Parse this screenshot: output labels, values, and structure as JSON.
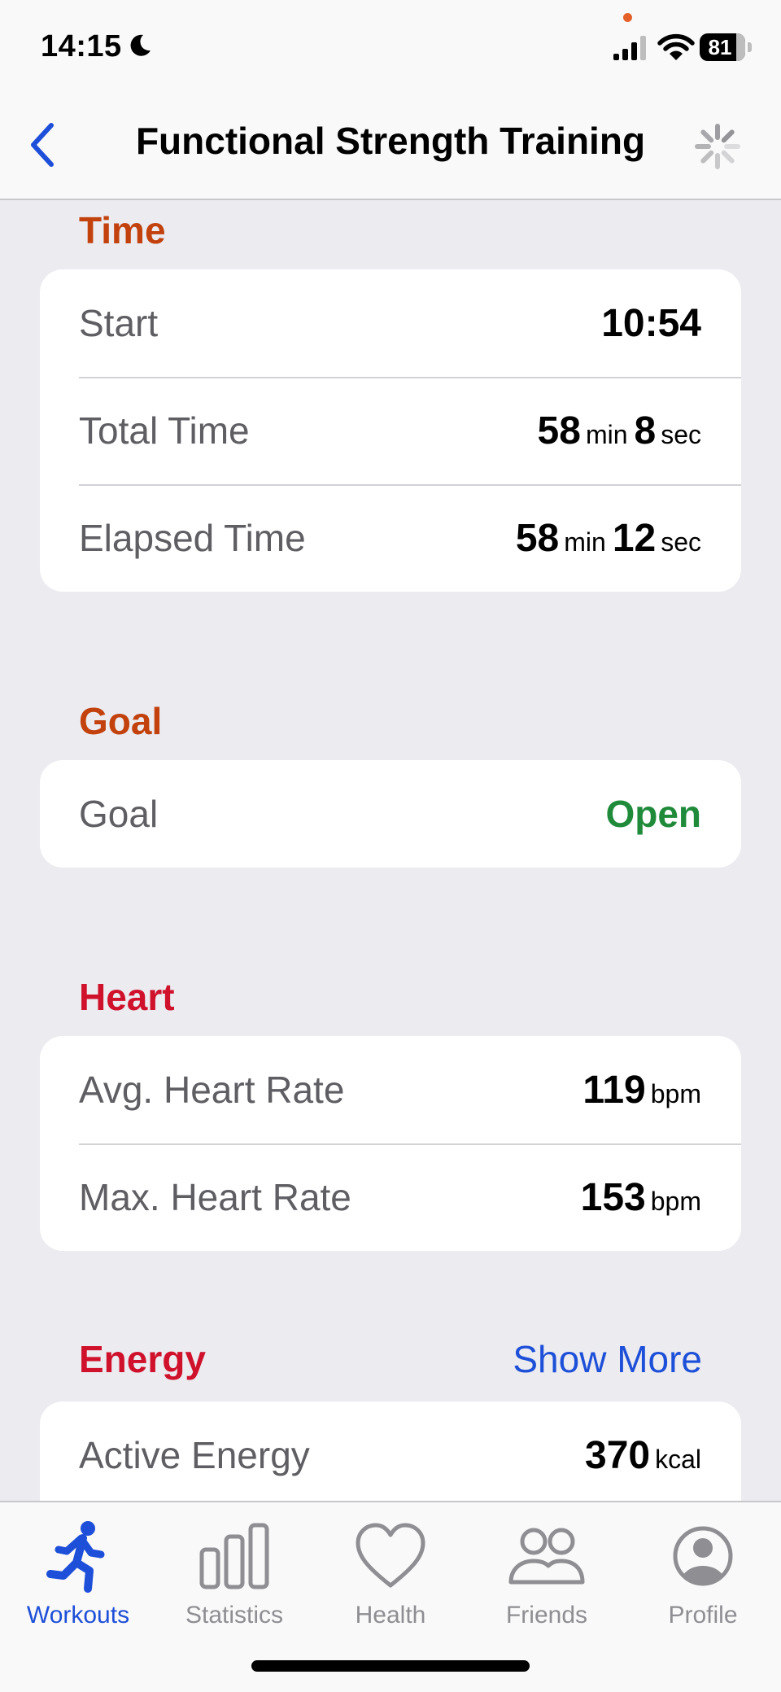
{
  "status_bar": {
    "time": "14:15",
    "battery": "81",
    "battery_level": 0.81,
    "dot_color": "#E4622A"
  },
  "nav": {
    "title": "Functional Strength Training",
    "back_icon": "chevron-left-icon",
    "loading_icon": "spinner-icon",
    "accent": "#1D4FD8"
  },
  "sections": {
    "time": {
      "header": "Time",
      "color": "#C2410C",
      "rows": [
        {
          "label": "Start",
          "value": "10:54"
        },
        {
          "label": "Total Time",
          "v1": "58",
          "u1": "min",
          "v2": "8",
          "u2": "sec"
        },
        {
          "label": "Elapsed Time",
          "v1": "58",
          "u1": "min",
          "v2": "12",
          "u2": "sec"
        }
      ]
    },
    "goal": {
      "header": "Goal",
      "color": "#C2410C",
      "rows": [
        {
          "label": "Goal",
          "value": "Open",
          "value_color": "#1F8A3A"
        }
      ]
    },
    "heart": {
      "header": "Heart",
      "color": "#D0112B",
      "rows": [
        {
          "label": "Avg. Heart Rate",
          "value": "119",
          "unit": "bpm"
        },
        {
          "label": "Max. Heart Rate",
          "value": "153",
          "unit": "bpm"
        }
      ]
    },
    "energy": {
      "header": "Energy",
      "color": "#D0112B",
      "show_more": "Show More",
      "rows": [
        {
          "label": "Active Energy",
          "value": "370",
          "unit": "kcal"
        }
      ]
    }
  },
  "tabs": [
    {
      "label": "Workouts",
      "icon": "running-figure-icon",
      "active": true
    },
    {
      "label": "Statistics",
      "icon": "bar-chart-icon",
      "active": false
    },
    {
      "label": "Health",
      "icon": "heart-icon",
      "active": false
    },
    {
      "label": "Friends",
      "icon": "people-icon",
      "active": false
    },
    {
      "label": "Profile",
      "icon": "profile-icon",
      "active": false
    }
  ],
  "tab_colors": {
    "active": "#1D4FD8",
    "inactive": "#8E8E93"
  }
}
